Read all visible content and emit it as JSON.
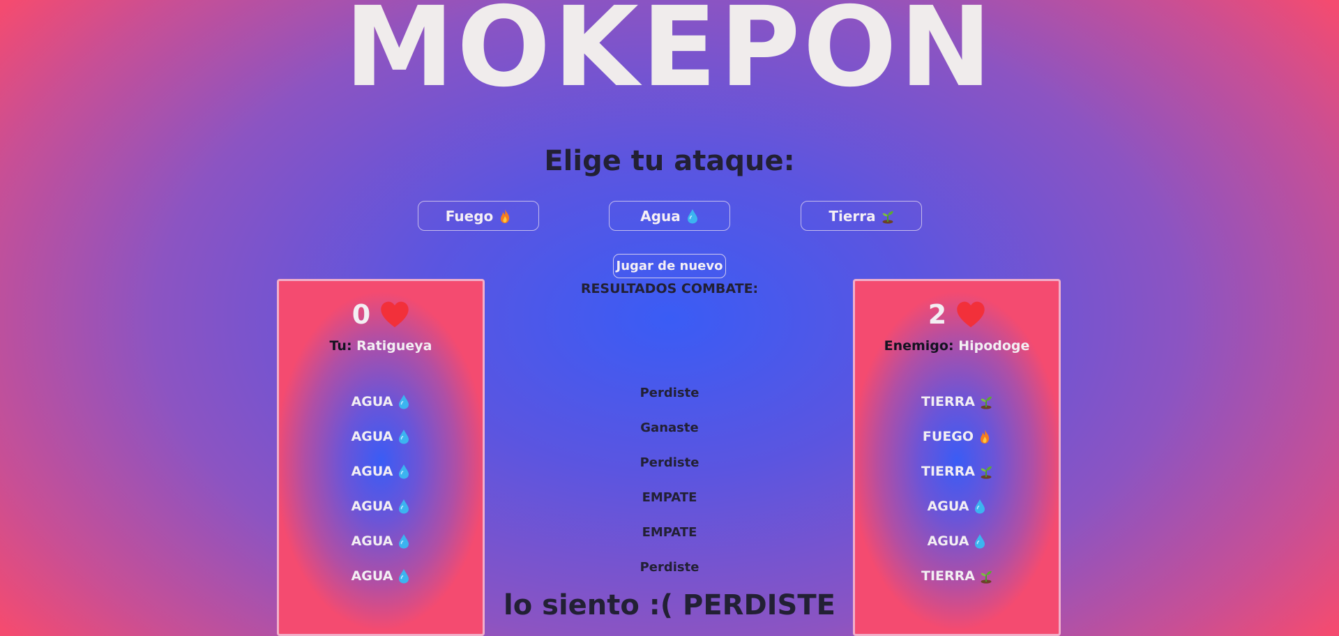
{
  "game": {
    "title": "MOKEPON",
    "attack_prompt": "Elige tu ataque:",
    "attack_buttons": [
      {
        "label": "Fuego",
        "icon": "fire-icon"
      },
      {
        "label": "Agua",
        "icon": "water-drop-icon"
      },
      {
        "label": "Tierra",
        "icon": "seedling-icon"
      }
    ],
    "replay_label": "Jugar de nuevo",
    "results_title": "RESULTADOS COMBATE:",
    "final_message": "lo siento :( PERDISTE"
  },
  "player": {
    "lives": "0",
    "label": "Tu:",
    "pet_name": "Ratigueya",
    "moves": [
      {
        "label": "AGUA",
        "icon": "water-drop-icon"
      },
      {
        "label": "AGUA",
        "icon": "water-drop-icon"
      },
      {
        "label": "AGUA",
        "icon": "water-drop-icon"
      },
      {
        "label": "AGUA",
        "icon": "water-drop-icon"
      },
      {
        "label": "AGUA",
        "icon": "water-drop-icon"
      },
      {
        "label": "AGUA",
        "icon": "water-drop-icon"
      }
    ]
  },
  "enemy": {
    "lives": "2",
    "label": "Enemigo:",
    "pet_name": "Hipodoge",
    "moves": [
      {
        "label": "TIERRA",
        "icon": "seedling-icon"
      },
      {
        "label": "FUEGO",
        "icon": "fire-icon"
      },
      {
        "label": "TIERRA",
        "icon": "seedling-icon"
      },
      {
        "label": "AGUA",
        "icon": "water-drop-icon"
      },
      {
        "label": "AGUA",
        "icon": "water-drop-icon"
      },
      {
        "label": "TIERRA",
        "icon": "seedling-icon"
      }
    ]
  },
  "results": [
    "Perdiste",
    "Ganaste",
    "Perdiste",
    "EMPATE",
    "EMPATE",
    "Perdiste"
  ],
  "colors": {
    "background_center": "#3a5cf5",
    "background_edge": "#f44b70",
    "heart": "#f2303a",
    "title_text": "#f0ecec",
    "dark_text": "#222034"
  }
}
